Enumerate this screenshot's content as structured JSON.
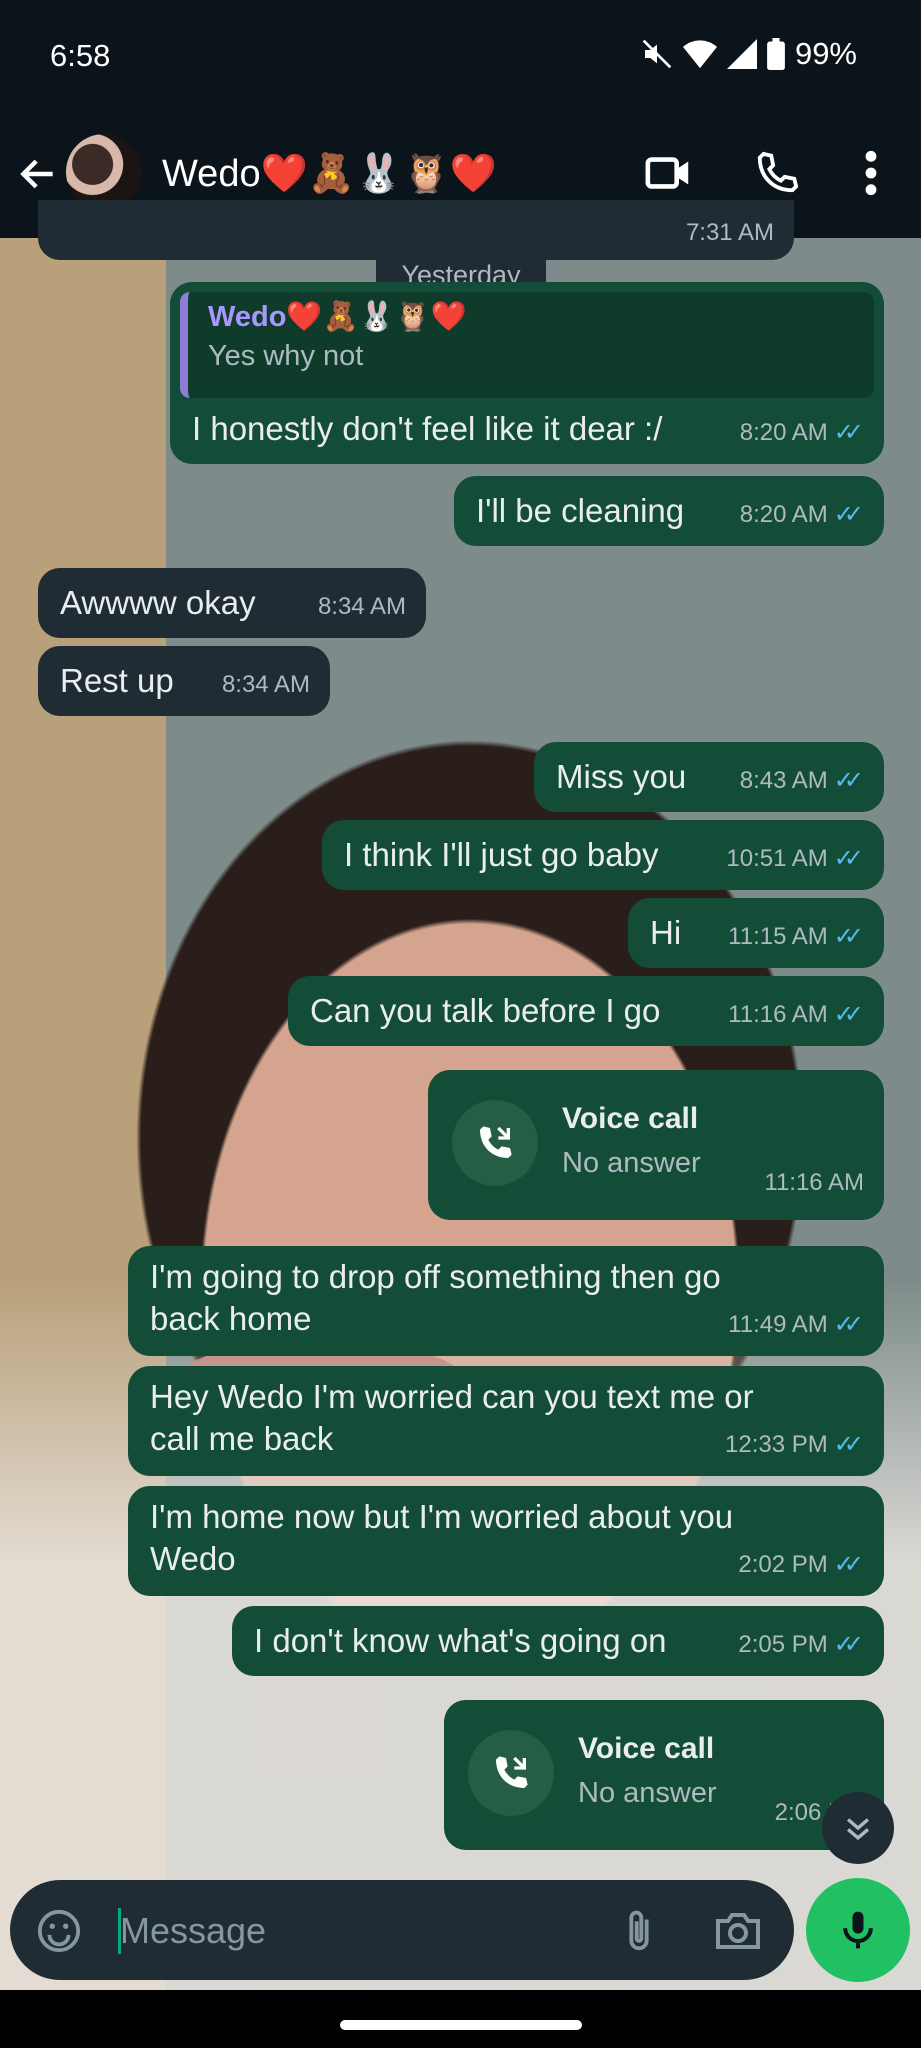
{
  "status": {
    "time": "6:58",
    "battery": "99%"
  },
  "header": {
    "contact_name": "Wedo❤️🧸🐰🦉❤️"
  },
  "date_chip": "Yesterday",
  "partial_top_time": "7:31 AM",
  "quoted": {
    "author": "Wedo❤️🧸🐰🦉❤️",
    "text": "Yes why not"
  },
  "messages": [
    {
      "text": "I honestly don't feel like it dear :/",
      "time": "8:20 AM"
    },
    {
      "text": "I'll be cleaning",
      "time": "8:20 AM"
    },
    {
      "text": "Awwww okay",
      "time": "8:34 AM"
    },
    {
      "text": "Rest up",
      "time": "8:34 AM"
    },
    {
      "text": "Miss you",
      "time": "8:43 AM"
    },
    {
      "text": "I think I'll just go baby",
      "time": "10:51 AM"
    },
    {
      "text": "Hi",
      "time": "11:15 AM"
    },
    {
      "text": "Can you talk before I go",
      "time": "11:16 AM"
    },
    {
      "text": "I'm going to drop off something then go back home",
      "time": "11:49 AM"
    },
    {
      "text": "Hey Wedo I'm worried can you text me or call me back",
      "time": "12:33 PM"
    },
    {
      "text": "I'm home now but I'm worried about you Wedo",
      "time": "2:02 PM"
    },
    {
      "text": "I don't know what's going on",
      "time": "2:05 PM"
    }
  ],
  "calls": [
    {
      "title": "Voice call",
      "status": "No answer",
      "time": "11:16 AM"
    },
    {
      "title": "Voice call",
      "status": "No answer",
      "time": "2:06 PM"
    }
  ],
  "composer": {
    "placeholder": "Message"
  },
  "colors": {
    "outgoing": "#144d37",
    "incoming": "#1f2c34",
    "accent": "#21c063",
    "tick": "#53bdeb"
  },
  "icons": [
    "back-arrow-icon",
    "video-call-icon",
    "phone-icon",
    "more-icon",
    "emoji-icon",
    "attach-icon",
    "camera-icon",
    "mic-icon",
    "scroll-down-icon",
    "call-back-icon"
  ]
}
